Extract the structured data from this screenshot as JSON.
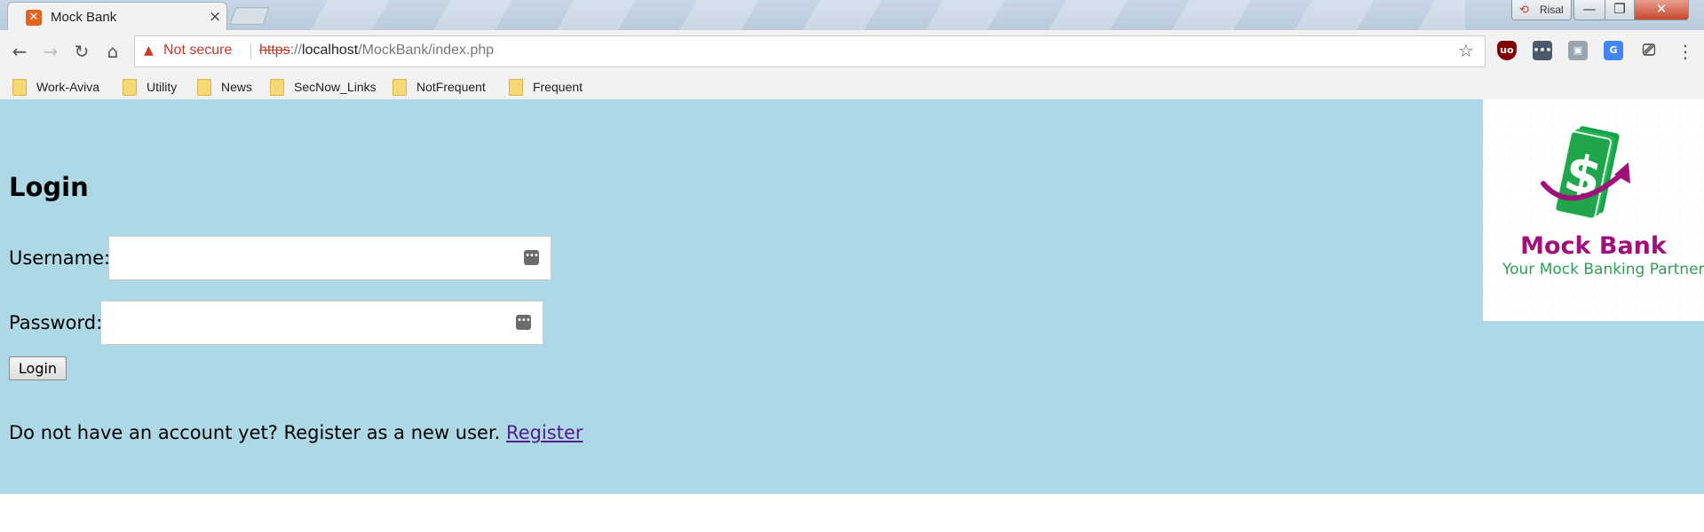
{
  "browser": {
    "tab": {
      "title": "Mock Bank",
      "close": "×"
    },
    "profile_name": "Risal",
    "window_controls": {
      "minimize": "—",
      "maximize": "❐",
      "close": "✕"
    },
    "nav": {
      "back": "←",
      "forward": "→",
      "reload": "↻",
      "home": "⌂"
    },
    "address_bar": {
      "security_label": "Not secure",
      "url_scheme": "https",
      "url_separator": "://",
      "url_host": "localhost",
      "url_path": "/MockBank/index.php"
    },
    "extensions": [
      "ublock-origin-icon",
      "password-manager-icon",
      "extension-icon",
      "google-translate-icon",
      "cast-icon"
    ],
    "bookmarks": [
      "Work-Aviva",
      "Utility",
      "News",
      "SecNow_Links",
      "NotFrequent",
      "Frequent"
    ]
  },
  "page": {
    "heading": "Login",
    "username_label": "Username:",
    "username_value": "",
    "password_label": "Password:",
    "password_value": "",
    "login_button": "Login",
    "register_prompt": "Do not have an account yet? Register as a new user.",
    "register_link": "Register"
  },
  "logo": {
    "name": "Mock Bank",
    "tagline": "Your Mock Banking Partner!",
    "colors": {
      "brand": "#a0107a",
      "tagline": "#2f9e55",
      "money": "#1fa64b",
      "page_bg": "#add8e6"
    }
  }
}
